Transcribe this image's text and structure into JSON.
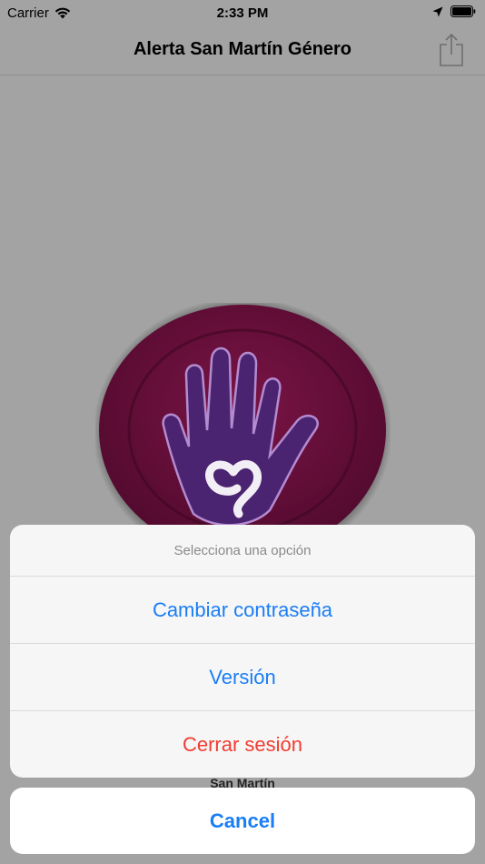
{
  "status_bar": {
    "carrier": "Carrier",
    "time": "2:33 PM",
    "icons": [
      "wifi-icon",
      "location-arrow-icon",
      "battery-icon"
    ]
  },
  "nav_bar": {
    "title": "Alerta San Martín Género",
    "share_icon": "share-icon"
  },
  "content": {
    "alert_button_icon": "hand-heart-icon",
    "peek_label": "San Martín"
  },
  "action_sheet": {
    "title": "Selecciona una opción",
    "options": [
      {
        "label": "Cambiar contraseña",
        "style": "default"
      },
      {
        "label": "Versión",
        "style": "default"
      },
      {
        "label": "Cerrar sesión",
        "style": "destructive"
      }
    ],
    "cancel_label": "Cancel"
  },
  "colors": {
    "accent": "#1a7ef5",
    "destructive": "#f23b30",
    "dimmed_background": "#a3a3a3",
    "button_maroon": "#5c0a34",
    "hand_purple": "#4b2471"
  }
}
